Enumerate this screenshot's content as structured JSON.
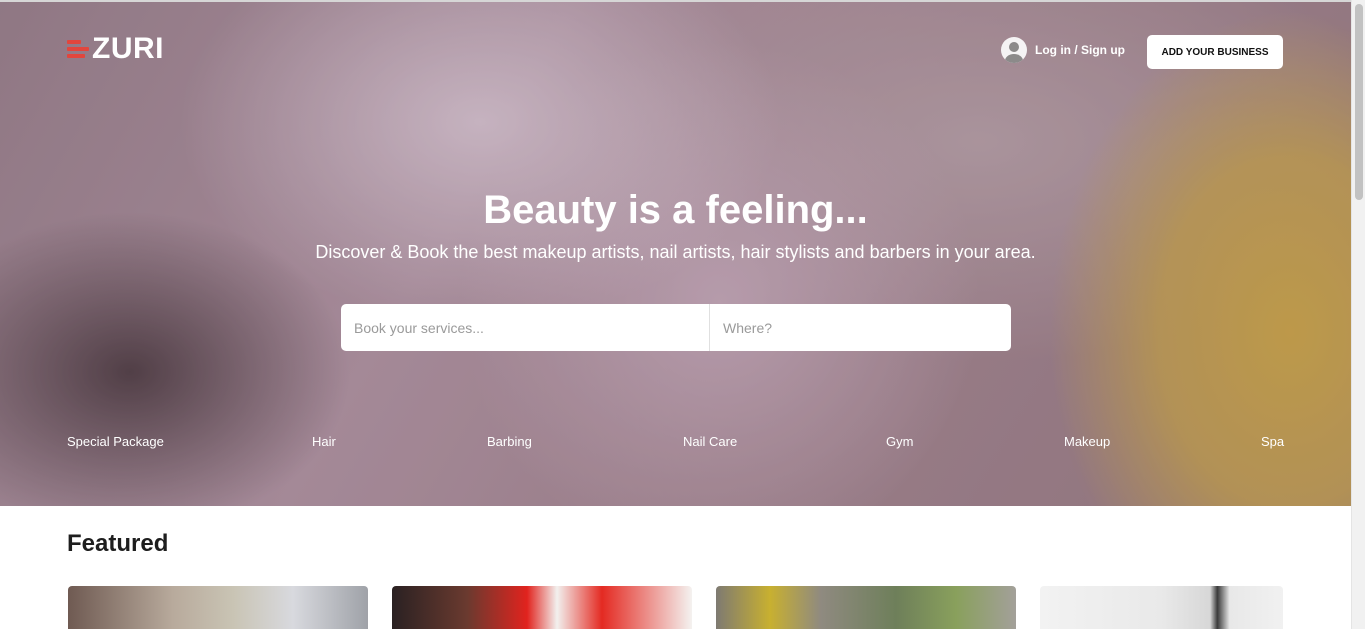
{
  "header": {
    "logo_text": "ZURI",
    "login_label": "Log in / Sign up",
    "add_business_label": "ADD YOUR BUSINESS"
  },
  "hero": {
    "headline": "Beauty is a feeling...",
    "subline": "Discover & Book the best makeup artists, nail artists, hair stylists and barbers in your area."
  },
  "search": {
    "service_placeholder": "Book your services...",
    "location_placeholder": "Where?"
  },
  "categories": [
    "Special Package",
    "Hair",
    "Barbing",
    "Nail Care",
    "Gym",
    "Makeup",
    "Spa"
  ],
  "featured": {
    "title": "Featured"
  },
  "colors": {
    "brand_red": "#e2463d",
    "button_bg": "#ffffff",
    "text_dark": "#1e1e1e"
  },
  "icons": {
    "logo": "zuri-logo-icon",
    "account": "user-avatar-icon"
  }
}
